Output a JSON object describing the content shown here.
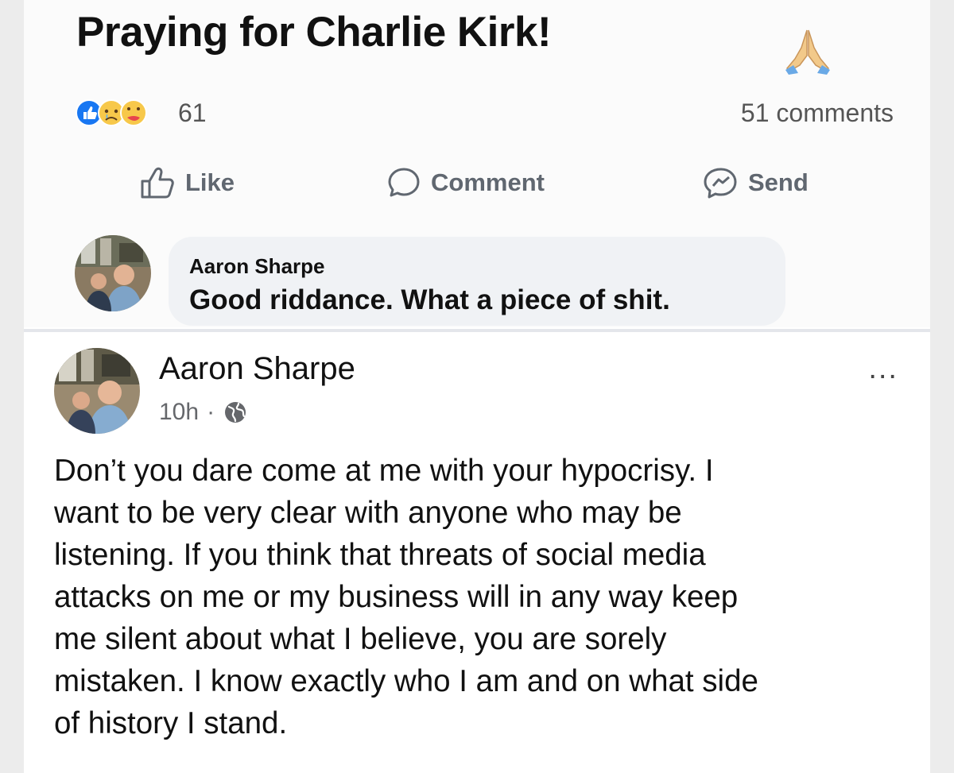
{
  "original_post": {
    "title": "Praying for Charlie Kirk!",
    "title_emoji": "folded-hands-emoji",
    "reaction_icons": [
      "like-icon",
      "sad-icon",
      "care-icon"
    ],
    "reaction_count": "61",
    "comments_count": "51 comments",
    "actions": {
      "like_label": "Like",
      "comment_label": "Comment",
      "send_label": "Send"
    }
  },
  "comment": {
    "author": "Aaron Sharpe",
    "text": "Good riddance. What a piece of shit."
  },
  "post": {
    "author": "Aaron Sharpe",
    "time": "10h",
    "separator": "·",
    "privacy_icon": "globe-icon",
    "more_icon": "more-options-icon",
    "more_label": "...",
    "body": "Don’t you dare come at me with your hypocrisy. I\nwant to be very clear with anyone who may be\nlistening. If you think that threats of social media\nattacks on me or my business will in any way keep\nme silent about what I believe, you are sorely\nmistaken. I know exactly who I am and on what side\nof history I stand."
  },
  "colors": {
    "like_blue": "#1877f2",
    "action_gray": "#606770",
    "bubble_bg": "#f0f2f5",
    "secondary_text": "#65676b"
  }
}
